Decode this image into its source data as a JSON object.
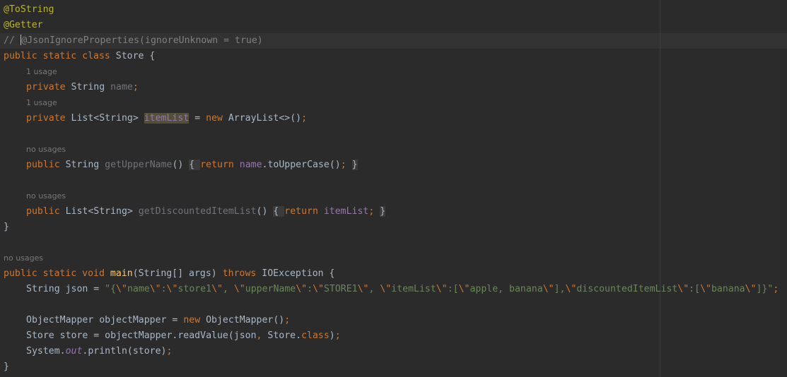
{
  "code": {
    "l1_ann": "@ToString",
    "l2_ann": "@Getter",
    "l3_prefix": "// ",
    "l3_rest": "@JsonIgnoreProperties(ignoreUnknown = true)",
    "l4_kw": "public static class",
    "l4_rest": " Store {",
    "hint_usage_1": "1 usage",
    "l5_kw": "private",
    "l5_type": " String ",
    "l5_field": "name",
    "l5_semi": ";",
    "hint_usage_2": "1 usage",
    "l6_kw": "private",
    "l6_type": " List<String> ",
    "l6_field": "itemList",
    "l6_eq": " = ",
    "l6_new": "new",
    "l6_rest": " ArrayList<>()",
    "l6_semi": ";",
    "hint_nousage_1": "no usages",
    "l7_kw": "public",
    "l7_type": " String ",
    "l7_method": "getUpperName",
    "l7_paren": "()",
    "l7_sp": " ",
    "l7_lbrace": "{ ",
    "l7_ret": "return",
    "l7_sp2": " ",
    "l7_field": "name",
    "l7_call": ".toUpperCase()",
    "l7_semi": ";",
    "l7_sp3": " ",
    "l7_rbrace": "}",
    "hint_nousage_2": "no usages",
    "l8_kw": "public",
    "l8_type": " List<String> ",
    "l8_method": "getDiscountedItemList",
    "l8_paren": "()",
    "l8_sp": " ",
    "l8_lbrace": "{ ",
    "l8_ret": "return",
    "l8_sp2": " ",
    "l8_field": "itemList",
    "l8_semi": ";",
    "l8_sp3": " ",
    "l8_rbrace": "}",
    "l9_close": "}",
    "hint_nousage_3": "no usages",
    "l10_kw": "public static void",
    "l10_sp": " ",
    "l10_method": "main",
    "l10_rest": "(String[] args) ",
    "l10_throws": "throws",
    "l10_rest2": " IOException {",
    "l11_decl": "String json = ",
    "l11_s1": "\"{",
    "l11_e1": "\\\"",
    "l11_s2": "name",
    "l11_e2": "\\\"",
    "l11_s3": ":",
    "l11_e3": "\\\"",
    "l11_s4": "store1",
    "l11_e4": "\\\"",
    "l11_s5": ", ",
    "l11_e5": "\\\"",
    "l11_s6": "upperName",
    "l11_e6": "\\\"",
    "l11_s7": ":",
    "l11_e7": "\\\"",
    "l11_s8": "STORE1",
    "l11_e8": "\\\"",
    "l11_s9": ", ",
    "l11_e9": "\\\"",
    "l11_s10": "itemList",
    "l11_e10": "\\\"",
    "l11_s11": ":[",
    "l11_e11": "\\\"",
    "l11_s12": "apple, banana",
    "l11_e12": "\\\"",
    "l11_s13": "],",
    "l11_e13": "\\\"",
    "l11_s14": "discountedItemList",
    "l11_e14": "\\\"",
    "l11_s15": ":[",
    "l11_e15": "\\\"",
    "l11_s16": "banana",
    "l11_e16": "\\\"",
    "l11_s17": "]}\"",
    "l11_semi": ";",
    "l12_rest": "ObjectMapper objectMapper = ",
    "l12_new": "new",
    "l12_rest2": " ObjectMapper()",
    "l12_semi": ";",
    "l13_rest": "Store store = objectMapper.readValue(json",
    "l13_comma": ",",
    "l13_rest2": " Store.",
    "l13_class": "class",
    "l13_rest3": ")",
    "l13_semi": ";",
    "l14_rest": "System.",
    "l14_out": "out",
    "l14_rest2": ".println(store)",
    "l14_semi": ";",
    "l15_close": "}"
  }
}
